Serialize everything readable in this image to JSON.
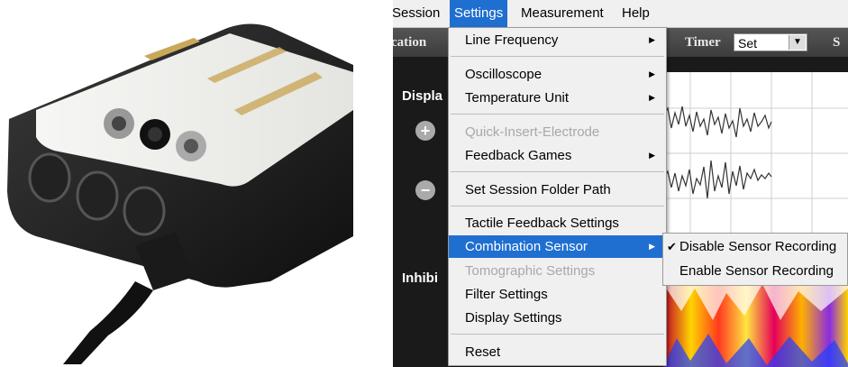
{
  "menubar": {
    "session": "Session",
    "settings": "Settings",
    "measurement": "Measurement",
    "help": "Help"
  },
  "toolbar": {
    "left_text": "cation",
    "timer_label": "Timer",
    "timer_value": "Set",
    "right_text": "S"
  },
  "left_labels": {
    "display": "Displa",
    "inhibit": "Inhibi"
  },
  "buttons": {
    "plus": "+",
    "minus": "−"
  },
  "settings_menu": {
    "items": [
      {
        "label": "Line Frequency"
      },
      {
        "label": "Oscilloscope"
      },
      {
        "label": "Temperature Unit"
      },
      {
        "label": "Quick-Insert-Electrode"
      },
      {
        "label": "Feedback Games"
      },
      {
        "label": "Set Session Folder Path"
      },
      {
        "label": "Tactile Feedback Settings"
      },
      {
        "label": "Combination Sensor"
      },
      {
        "label": "Tomographic Settings"
      },
      {
        "label": "Filter Settings"
      },
      {
        "label": "Display Settings"
      },
      {
        "label": "Reset"
      }
    ]
  },
  "combination_submenu": {
    "items": [
      {
        "label": "Disable Sensor Recording"
      },
      {
        "label": "Enable Sensor Recording"
      }
    ]
  },
  "colors": {
    "highlight": "#1f6fd0",
    "menu_bg": "#f0f0f0",
    "disabled_text": "#a8a8a8"
  }
}
